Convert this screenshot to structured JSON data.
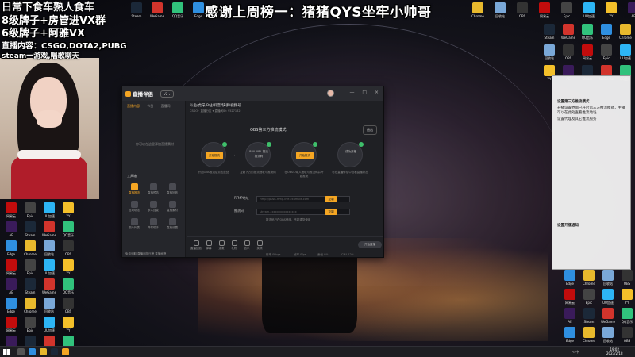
{
  "overlay": {
    "ticker": "感谢上周榜一：猪猪QYS坐牢小帅哥",
    "lines": [
      "日常下食车熟人食车",
      "8级牌子+房管进VX群",
      "6级牌子+阿雅VX",
      "直播内容：CSGO,DOTA2,PUBG",
      "steam一游戏,唱歌聊天"
    ]
  },
  "app": {
    "name": "直播伴侣",
    "version": "V2 ▾",
    "window_controls": "— □ ×",
    "left_tabs": [
      "直播内容",
      "节目",
      "直播间"
    ],
    "left_hint": "你可以在这里添加直播素材",
    "tools_title": "工具箱",
    "tools": [
      {
        "label": "直播推流",
        "active": true
      },
      {
        "label": "直播预告",
        "active": false
      },
      {
        "label": "直播回放",
        "active": false
      },
      {
        "label": "互动玩法",
        "active": false
      },
      {
        "label": "多人连麦",
        "active": false
      },
      {
        "label": "直播素材",
        "active": false
      },
      {
        "label": "观众列表",
        "active": false
      },
      {
        "label": "弹幕助手",
        "active": false
      },
      {
        "label": "直播设置",
        "active": false
      }
    ],
    "left_bottom": "免费领取  直播间排行榜  直播秘籍",
    "room_title": "斗鱼/虎牙/B站/抖音/快手/视频号",
    "room_meta": "CSGO · 直播分区 ▾   直播间ID: 9527182",
    "mode_title": "OBS第三方推流模式",
    "exit_label": "退出",
    "steps": [
      {
        "label": "开始推流",
        "desc": "开始OBS推流后点击此处",
        "done": true
      },
      {
        "label": "RML URL\n推流 推流码",
        "desc": "复制下方的推流地址与推流码",
        "done": true
      },
      {
        "label": "开始推流",
        "desc": "在OBS中填入地址与推流码并开始推流",
        "done": true
      },
      {
        "label": "成功开播",
        "desc": "可在直播伴侣中查看直播状态",
        "done": true
      }
    ],
    "fields": [
      {
        "label": "RTMP地址",
        "value": "rtmp://push-rtmp.live.example.com",
        "copy": "复制"
      },
      {
        "label": "推流码",
        "value": "stream-xxxxxxxxxxxxxxxx",
        "copy": "复制"
      }
    ],
    "note": "推流码已在OBS使用，不能重复使用",
    "bottom_items": [
      "直播回放",
      "弹幕",
      "连麦",
      "礼物",
      "音乐",
      "美颜"
    ],
    "start_label": "开始直播",
    "stats": [
      "码率 0kbps",
      "帧率 0fps",
      "丢帧 0%",
      "CPU 12%"
    ]
  },
  "desktop_icons": [
    {
      "label": "Steam",
      "color": "#1b2838"
    },
    {
      "label": "WeGame",
      "color": "#d2342c"
    },
    {
      "label": "QQ音乐",
      "color": "#31c27c"
    },
    {
      "label": "Edge",
      "color": "#2f8fe0"
    },
    {
      "label": "Chrome",
      "color": "#e8b92d"
    },
    {
      "label": "回收站",
      "color": "#7aa8d8"
    },
    {
      "label": "OBS",
      "color": "#333333"
    },
    {
      "label": "网易云",
      "color": "#c20c0c"
    },
    {
      "label": "Epic",
      "color": "#444444"
    },
    {
      "label": "UU加速",
      "color": "#2db5f5"
    },
    {
      "label": "YY",
      "color": "#f4c02a"
    },
    {
      "label": "AE",
      "color": "#3a1b5a"
    }
  ],
  "notifications": [
    "设置第三方推流模式",
    "开播设置界面已开启第三方推流模式，主播可以在此处查看推流地址",
    "设置代理及其它推流服务",
    "设置开播通知"
  ],
  "taskbar": {
    "time": "19:02",
    "date": "2023/2/18",
    "tray": "⌃ ∿ 中"
  }
}
